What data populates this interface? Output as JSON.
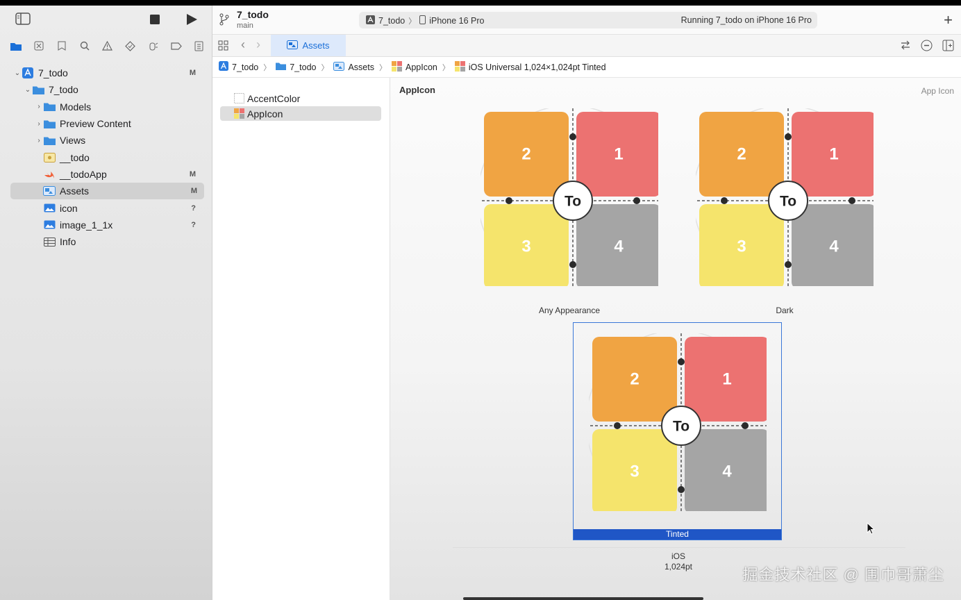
{
  "window": {
    "project_name": "7_todo",
    "branch": "main",
    "scheme": "7_todo",
    "destination": "iPhone 16 Pro",
    "run_status": "Running 7_todo on iPhone 16 Pro",
    "add_symbol": "+"
  },
  "sidebar": {
    "items": [
      {
        "label": "7_todo",
        "status": "M",
        "disclosure": "⌄",
        "icon": "project-icon"
      },
      {
        "label": "7_todo",
        "status": "",
        "disclosure": "⌄",
        "icon": "folder-icon"
      },
      {
        "label": "Models",
        "status": "",
        "disclosure": "›",
        "icon": "folder-icon"
      },
      {
        "label": "Preview Content",
        "status": "",
        "disclosure": "›",
        "icon": "folder-icon"
      },
      {
        "label": "Views",
        "status": "",
        "disclosure": "›",
        "icon": "folder-icon"
      },
      {
        "label": "__todo",
        "status": "",
        "disclosure": "",
        "icon": "entitlements-icon"
      },
      {
        "label": "__todoApp",
        "status": "M",
        "disclosure": "",
        "icon": "swift-icon"
      },
      {
        "label": "Assets",
        "status": "M",
        "disclosure": "",
        "icon": "asset-catalog-icon"
      },
      {
        "label": "icon",
        "status": "?",
        "disclosure": "",
        "icon": "image-icon"
      },
      {
        "label": "image_1_1x",
        "status": "?",
        "disclosure": "",
        "icon": "image-icon"
      },
      {
        "label": "Info",
        "status": "",
        "disclosure": "",
        "icon": "plist-icon"
      }
    ]
  },
  "editor": {
    "tab_label": "Assets",
    "breadcrumb": [
      "7_todo",
      "7_todo",
      "Assets",
      "AppIcon",
      "iOS Universal 1,024×1,024pt Tinted"
    ]
  },
  "asset_list": {
    "items": [
      "AccentColor",
      "AppIcon"
    ]
  },
  "detail": {
    "title": "AppIcon",
    "kind": "App Icon",
    "variants": [
      "Any Appearance",
      "Dark",
      "Tinted"
    ],
    "icon_tiles": [
      "2",
      "1",
      "3",
      "4"
    ],
    "icon_center": "To",
    "platform": "iOS",
    "size": "1,024pt",
    "colors": {
      "tile_orange": "#f0a443",
      "tile_red": "#ec7271",
      "tile_yellow": "#f5e46c",
      "tile_gray": "#a5a5a5",
      "accent_blue": "#1a6fd8",
      "tinted_bar": "#1f56c6"
    }
  },
  "watermark": "掘金技术社区 @ 围巾哥萧尘"
}
